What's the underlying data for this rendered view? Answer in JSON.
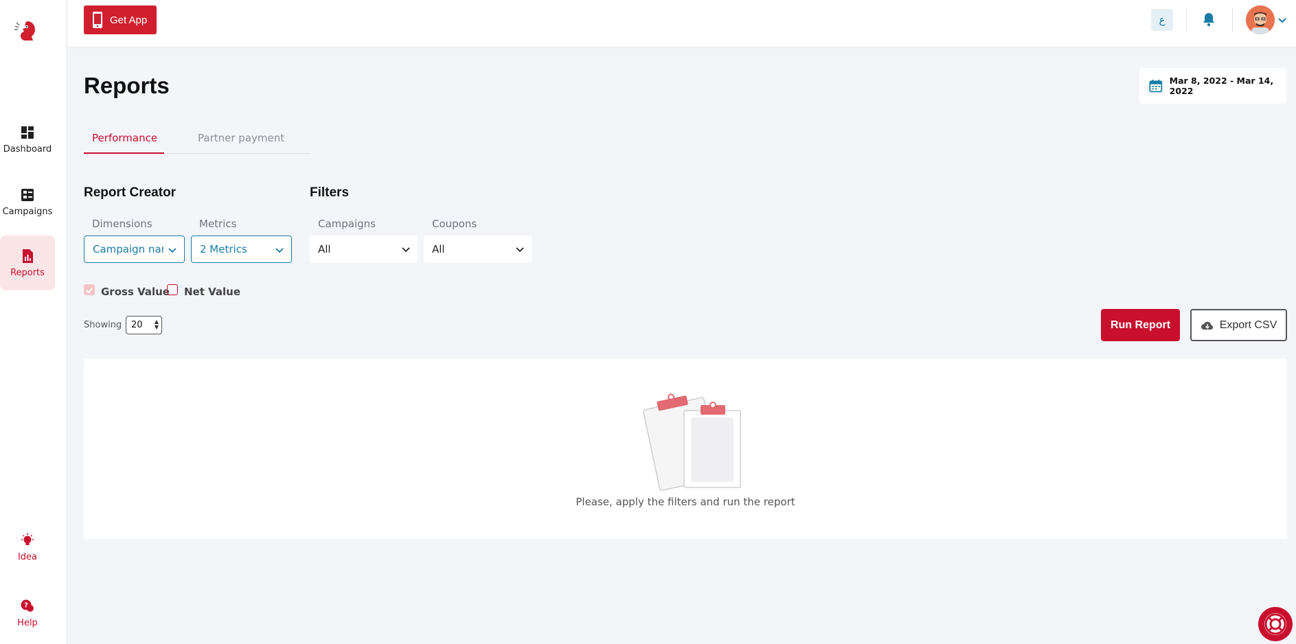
{
  "sidebar": {
    "items": [
      {
        "label": "Dashboard",
        "icon": "dashboard-icon"
      },
      {
        "label": "Campaigns",
        "icon": "campaigns-icon"
      },
      {
        "label": "Reports",
        "icon": "reports-icon"
      },
      {
        "label": "Idea",
        "icon": "lightbulb-icon"
      },
      {
        "label": "Help",
        "icon": "help-chat-icon"
      }
    ]
  },
  "topbar": {
    "get_app_label": "Get App",
    "lang_label": "ع"
  },
  "page": {
    "title": "Reports",
    "date_range": "Mar 8, 2022 - Mar 14, 2022"
  },
  "tabs": [
    {
      "label": "Performance",
      "active": true
    },
    {
      "label": "Partner payment",
      "active": false
    }
  ],
  "report_creator": {
    "title": "Report Creator",
    "dimensions_label": "Dimensions",
    "dimensions_value": "Campaign name",
    "metrics_label": "Metrics",
    "metrics_value": "2 Metrics"
  },
  "filters": {
    "title": "Filters",
    "campaigns_label": "Campaigns",
    "campaigns_value": "All",
    "coupons_label": "Coupons",
    "coupons_value": "All"
  },
  "values": {
    "gross_label": "Gross Value",
    "gross_checked": true,
    "net_label": "Net Value",
    "net_checked": false
  },
  "showing": {
    "label": "Showing",
    "value": "20"
  },
  "actions": {
    "run_label": "Run Report",
    "export_label": "Export CSV"
  },
  "empty_state": {
    "message": "Please, apply the filters and run the report"
  },
  "colors": {
    "brand_red": "#c8102e",
    "accent_blue": "#1a7ca6",
    "background": "#f4f5f9"
  }
}
